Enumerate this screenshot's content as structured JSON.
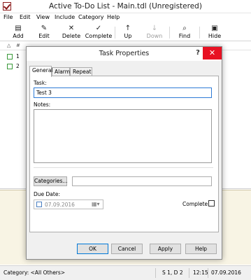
{
  "window": {
    "title": "Active To-Do List - Main.tdl (Unregistered)"
  },
  "menu": [
    "File",
    "Edit",
    "View",
    "Include",
    "Category",
    "Help"
  ],
  "toolbar": [
    {
      "label": "Add",
      "icon": "add-task-icon"
    },
    {
      "label": "Edit",
      "icon": "edit-icon"
    },
    {
      "label": "Delete",
      "icon": "delete-icon"
    },
    {
      "label": "Complete",
      "icon": "checkmark-icon"
    },
    {
      "label": "Up",
      "icon": "arrow-up-icon"
    },
    {
      "label": "Down",
      "icon": "arrow-down-icon",
      "disabled": true
    },
    {
      "label": "Find",
      "icon": "find-icon"
    },
    {
      "label": "Hide",
      "icon": "hide-icon"
    }
  ],
  "tasklist": {
    "header": [
      "#"
    ],
    "rows": [
      {
        "num": "1"
      },
      {
        "num": "2"
      }
    ]
  },
  "statusbar": {
    "category": "Category: <All Others>",
    "counts": "S 1, D 2",
    "time": "12:15",
    "date": "07.09.2016"
  },
  "dialog": {
    "title": "Task Properties",
    "help_glyph": "?",
    "close_glyph": "✕",
    "tabs": [
      "General",
      "Alarm",
      "Repeat"
    ],
    "task_label": "Task:",
    "task_value": "Test 3",
    "notes_label": "Notes:",
    "categories_button": "Categories...",
    "due_date_label": "Due Date:",
    "due_date_value": "07.09.2016",
    "complete_label": "Complete",
    "buttons": {
      "ok": "OK",
      "cancel": "Cancel",
      "apply": "Apply",
      "help": "Help"
    }
  },
  "colors": {
    "close_red": "#e81123",
    "focus_blue": "#2e7bd6",
    "brand_red": "#8b1a1a"
  }
}
